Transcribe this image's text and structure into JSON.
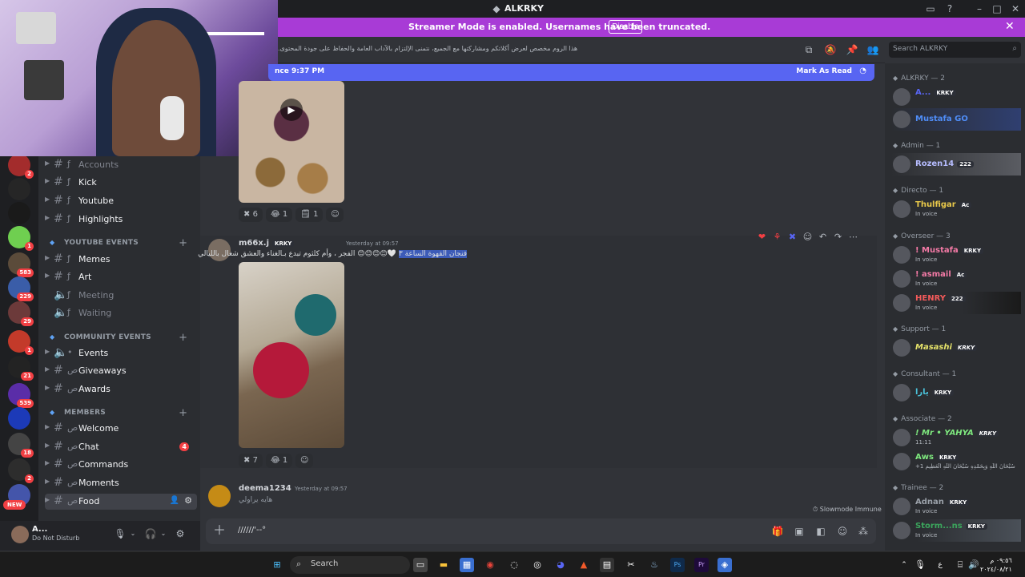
{
  "window": {
    "title": "ALKRKY"
  },
  "streamer_banner": {
    "message": "Streamer Mode is enabled. Usernames have been truncated.",
    "disable_label": "Disable"
  },
  "header": {
    "topic": ".هذا الروم مخصص لعرض أكلاتكم ومشاركتها مع الجميع، نتمنى الإلتزام بالآداب العامة والحفاظ على جودة المحتوى",
    "search_placeholder": "Search ALKRKY"
  },
  "new_messages_bar": {
    "since": "nce 9:37 PM",
    "mark_label": "Mark As Read"
  },
  "guild_badges": [
    "2",
    "1",
    "583",
    "229",
    "29",
    "1",
    "21",
    "539",
    "18",
    "2",
    "NEW"
  ],
  "channels": [
    {
      "label": "Accounts",
      "muted": true
    },
    {
      "label": "Kick"
    },
    {
      "label": "Youtube"
    },
    {
      "label": "Highlights"
    }
  ],
  "categories": {
    "youtube": "YOUTUBE EVENTS",
    "community": "COMMUNITY EVENTS",
    "members": "MEMBERS"
  },
  "youtube_channels": [
    {
      "label": "Memes"
    },
    {
      "label": "Art"
    },
    {
      "label": "Meeting",
      "muted": true
    },
    {
      "label": "Waiting",
      "muted": true
    }
  ],
  "community_channels": [
    {
      "label": "Events"
    },
    {
      "label": "Giveaways"
    },
    {
      "label": "Awards"
    }
  ],
  "member_channels": [
    {
      "label": "Welcome"
    },
    {
      "label": "Chat",
      "unread": "4"
    },
    {
      "label": "Commands"
    },
    {
      "label": "Moments"
    },
    {
      "label": "Food",
      "active": true
    }
  ],
  "user_panel": {
    "name": "A...",
    "status": "Do Not Disturb"
  },
  "messages": {
    "first_reactions": [
      {
        "emoji": "✖",
        "count": "6"
      },
      {
        "emoji": "😂",
        "count": "1"
      },
      {
        "emoji": "🗒",
        "count": "1"
      }
    ],
    "second": {
      "username": "m66x.j",
      "tag": "KRKY",
      "timestamp": "Yesterday at 09:57",
      "text_plain": "🤍😊😊😊😊 الفجر ، وأم كلثوم تبدع بـالغناء والعشق شغال بالليالي",
      "text_selected": "فنجان القهوة الساعة ٣",
      "reactions": [
        {
          "emoji": "✖",
          "count": "7"
        },
        {
          "emoji": "😂",
          "count": "1"
        }
      ]
    },
    "third": {
      "username": "deema1234",
      "timestamp": "Yesterday at 09:57",
      "text": "هايه يراولي"
    }
  },
  "slowmode": "Slowmode Immune",
  "composer": {
    "value": "//////'--°"
  },
  "members": {
    "roles": [
      {
        "label": "ALKRKY — 2"
      },
      {
        "label": "Admin — 1"
      },
      {
        "label": "Directo — 1"
      },
      {
        "label": "Overseer — 3"
      },
      {
        "label": "Support — 1"
      },
      {
        "label": "Consultant — 1"
      },
      {
        "label": "Associate — 2"
      },
      {
        "label": "Trainee — 2"
      }
    ],
    "list": [
      {
        "name": "A...",
        "tag": "KRKY",
        "color": "#5865f2"
      },
      {
        "name": "Mustafa GO",
        "color": "#4f8df7"
      },
      {
        "name": "Rozen14",
        "tag": "222",
        "color": "#b6bcff"
      },
      {
        "name": "Thulfigar",
        "tag": "Ac",
        "color": "#e8c84a",
        "sub": "In voice"
      },
      {
        "name": "! Mustafa",
        "tag": "KRKY",
        "color": "#f47aa6",
        "sub": "In voice"
      },
      {
        "name": "! asmail",
        "tag": "Ac",
        "color": "#f47aa6",
        "sub": "In voice"
      },
      {
        "name": "HENRY",
        "tag": "222",
        "color": "#f25a5a",
        "sub": "In voice"
      },
      {
        "name": "Masashi",
        "tag": "KRKY",
        "color": "#e6e36a"
      },
      {
        "name": "يارا",
        "tag": "KRKY",
        "color": "#4ac0d8"
      },
      {
        "name": "! Mr • YAHYA",
        "tag": "KRKY",
        "color": "#7ee87e",
        "sub": "11:11"
      },
      {
        "name": "Aws",
        "tag": "KRKY",
        "color": "#7ee87e",
        "sub": "+1 سُبْحَانَ اللَّهِ وَبِحَمْدِهِ سُبْحَانَ اللَّهِ الْعَظِيمِ"
      },
      {
        "name": "Adnan",
        "tag": "KRKY",
        "color": "#9aa0a8",
        "sub": "In voice"
      },
      {
        "name": "Storm...ns",
        "tag": "KRKY",
        "color": "#3ba55c",
        "sub": "In voice"
      }
    ]
  },
  "taskbar": {
    "search_placeholder": "Search",
    "time": "٠٩:٥٦ م",
    "date": "٢٠٢٤/٠٨/٢١"
  }
}
